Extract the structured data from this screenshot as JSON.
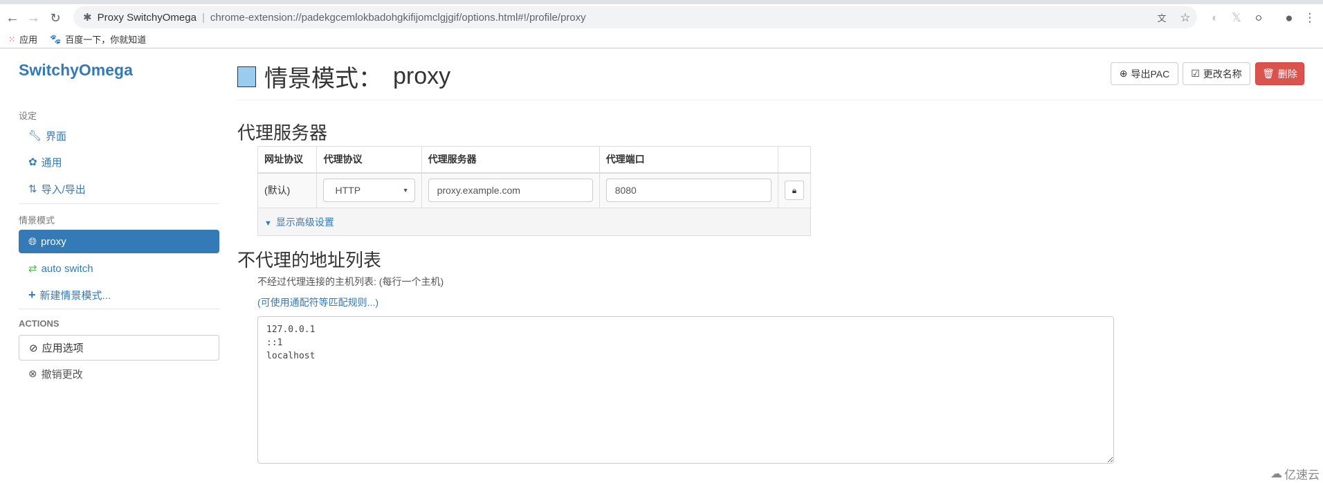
{
  "browser": {
    "tab_title": "Proxy SwitchyOmega",
    "url": "chrome-extension://padekgcemlokbadohgkifijomclgjgif/options.html#!/profile/proxy",
    "bookmarks": [
      {
        "label": "应用",
        "icon": "apps-grid-icon"
      },
      {
        "label": "百度一下，你就知道",
        "icon": "baidu-paw-icon"
      }
    ]
  },
  "sidebar": {
    "brand": "SwitchyOmega",
    "settings_header": "设定",
    "settings": [
      {
        "label": "界面",
        "icon": "wrench-icon"
      },
      {
        "label": "通用",
        "icon": "gear-icon"
      },
      {
        "label": "导入/导出",
        "icon": "import-export-icon"
      }
    ],
    "profiles_header": "情景模式",
    "profiles": [
      {
        "label": "proxy",
        "icon": "globe-icon",
        "active": true
      },
      {
        "label": "auto switch",
        "icon": "retweet-icon",
        "color": "#5cb85c"
      },
      {
        "label": "新建情景模式...",
        "icon": "plus-icon"
      }
    ],
    "actions_header": "ACTIONS",
    "apply": "应用选项",
    "discard": "撤销更改"
  },
  "header": {
    "title_prefix": "情景模式：",
    "profile_name": "proxy",
    "profile_color": "#99ccee",
    "export_pac": "导出PAC",
    "rename": "更改名称",
    "delete": "删除",
    "danger_color": "#d9534f"
  },
  "proxy_servers": {
    "heading": "代理服务器",
    "columns": [
      "网址协议",
      "代理协议",
      "代理服务器",
      "代理端口"
    ],
    "rows": [
      {
        "scheme": "(默认)",
        "protocol": "HTTP",
        "server": "proxy.example.com",
        "port": "8080"
      }
    ],
    "advanced": "显示高级设置"
  },
  "bypass": {
    "heading": "不代理的地址列表",
    "description": "不经过代理连接的主机列表: (每行一个主机)",
    "wildcard_link": "(可使用通配符等匹配规则...)",
    "value": "127.0.0.1\n::1\nlocalhost"
  },
  "watermark": "亿速云",
  "accent": "#337ab7"
}
